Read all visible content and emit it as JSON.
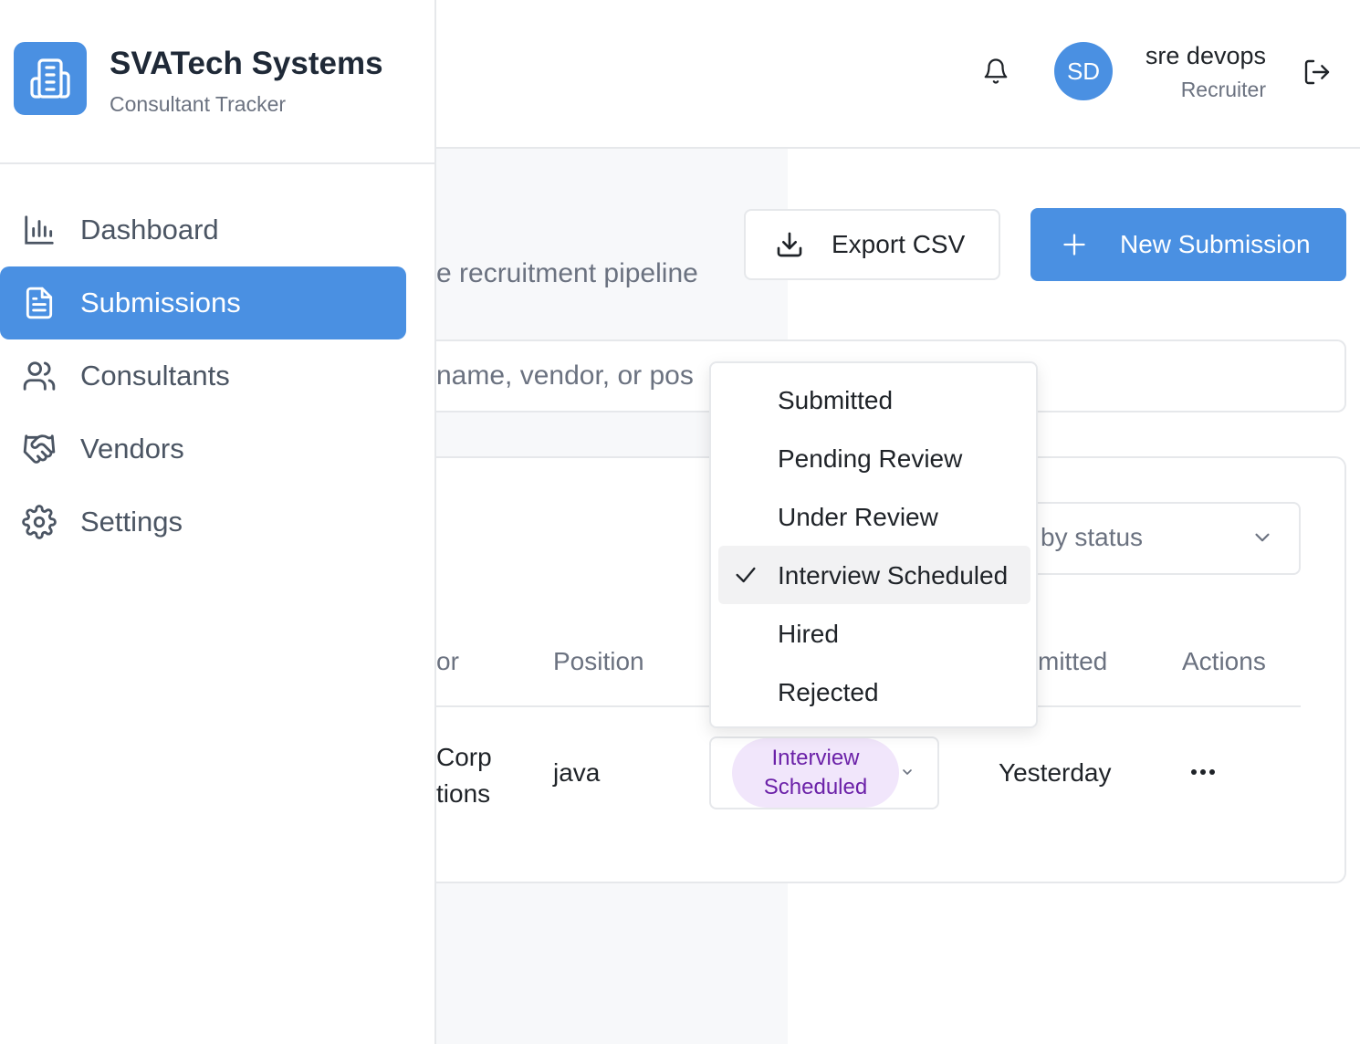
{
  "brand": {
    "name": "SVATech Systems",
    "subtitle": "Consultant Tracker"
  },
  "sidebar": {
    "items": [
      {
        "label": "Dashboard",
        "icon": "bar-chart-icon",
        "active": false
      },
      {
        "label": "Submissions",
        "icon": "document-icon",
        "active": true
      },
      {
        "label": "Consultants",
        "icon": "users-icon",
        "active": false
      },
      {
        "label": "Vendors",
        "icon": "handshake-icon",
        "active": false
      },
      {
        "label": "Settings",
        "icon": "gear-icon",
        "active": false
      }
    ]
  },
  "header": {
    "user": {
      "initials": "SD",
      "name": "sre devops",
      "role": "Recruiter"
    }
  },
  "page": {
    "subtitle_visible": "e recruitment pipeline",
    "export_label": "Export CSV",
    "new_label": "New Submission",
    "search_placeholder_visible": "name, vendor, or pos",
    "filter_placeholder_visible": "by status"
  },
  "table": {
    "headers": {
      "vendor": "or",
      "position": "Position",
      "submitted": "mitted",
      "actions": "Actions"
    },
    "rows": [
      {
        "vendor_line1": "Corp",
        "vendor_line2": "tions",
        "position": "java",
        "status": "Interview Scheduled",
        "submitted": "Yesterday"
      }
    ]
  },
  "status_menu": {
    "options": [
      "Submitted",
      "Pending Review",
      "Under Review",
      "Interview Scheduled",
      "Hired",
      "Rejected"
    ],
    "selected": "Interview Scheduled"
  },
  "colors": {
    "accent": "#4a90e2",
    "pill_bg": "#f1e6fb",
    "pill_text": "#6b21a8"
  }
}
